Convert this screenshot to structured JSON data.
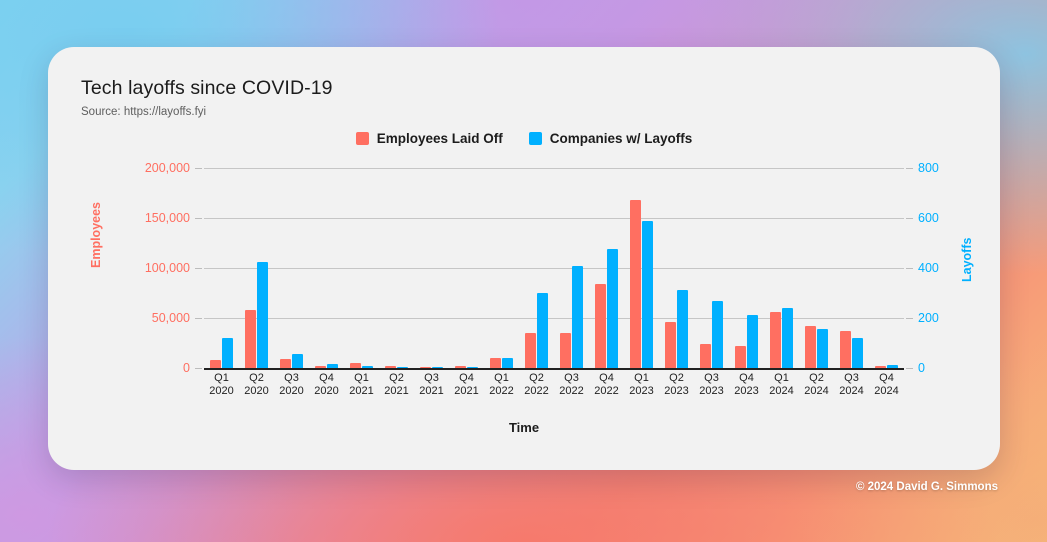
{
  "footer": {
    "credit": "© 2024 David G. Simmons"
  },
  "chart_data": {
    "type": "bar",
    "title": "Tech layoffs since COVID-19",
    "subtitle": "Source: https://layoffs.fyi",
    "xlabel": "Time",
    "ylabel": "Employees",
    "y2label": "Layoffs",
    "grid": true,
    "legend_position": "top-center",
    "ylim": [
      0,
      200000
    ],
    "y2lim": [
      0,
      800
    ],
    "yticks": [
      "0",
      "50,000",
      "100,000",
      "150,000",
      "200,000"
    ],
    "ytick_values": [
      0,
      50000,
      100000,
      150000,
      200000
    ],
    "y2ticks": [
      "0",
      "200",
      "400",
      "600",
      "800"
    ],
    "y2tick_values": [
      0,
      200,
      400,
      600,
      800
    ],
    "colors": {
      "employees": "#ff6f61",
      "companies": "#00b0ff",
      "card_background": "#f2f2f2",
      "grid": "#c6c6c6",
      "axis": "#222222"
    },
    "categories": [
      "Q1 2020",
      "Q2 2020",
      "Q3 2020",
      "Q4 2020",
      "Q1 2021",
      "Q2 2021",
      "Q3 2021",
      "Q4 2021",
      "Q1 2022",
      "Q2 2022",
      "Q3 2022",
      "Q4 2022",
      "Q1 2023",
      "Q2 2023",
      "Q3 2023",
      "Q4 2023",
      "Q1 2024",
      "Q2 2024",
      "Q3 2024",
      "Q4 2024"
    ],
    "categories_lines": [
      [
        "Q1",
        "2020"
      ],
      [
        "Q2",
        "2020"
      ],
      [
        "Q3",
        "2020"
      ],
      [
        "Q4",
        "2020"
      ],
      [
        "Q1",
        "2021"
      ],
      [
        "Q2",
        "2021"
      ],
      [
        "Q3",
        "2021"
      ],
      [
        "Q4",
        "2021"
      ],
      [
        "Q1",
        "2022"
      ],
      [
        "Q2",
        "2022"
      ],
      [
        "Q3",
        "2022"
      ],
      [
        "Q4",
        "2022"
      ],
      [
        "Q1",
        "2023"
      ],
      [
        "Q2",
        "2023"
      ],
      [
        "Q3",
        "2023"
      ],
      [
        "Q4",
        "2023"
      ],
      [
        "Q1",
        "2024"
      ],
      [
        "Q2",
        "2024"
      ],
      [
        "Q3",
        "2024"
      ],
      [
        "Q4",
        "2024"
      ]
    ],
    "series": [
      {
        "name": "Employees Laid Off",
        "axis": "left",
        "color": "#ff6f61",
        "values": [
          8000,
          58000,
          9500,
          2000,
          5500,
          2000,
          1500,
          2000,
          10000,
          35000,
          35000,
          84000,
          168000,
          46000,
          24000,
          22500,
          56000,
          42000,
          37000,
          2000
        ]
      },
      {
        "name": "Companies w/ Layoffs",
        "axis": "right",
        "color": "#00b0ff",
        "values": [
          120,
          425,
          57,
          18,
          10,
          5,
          5,
          6,
          40,
          300,
          410,
          475,
          588,
          312,
          270,
          212,
          240,
          158,
          120,
          12
        ]
      }
    ]
  }
}
